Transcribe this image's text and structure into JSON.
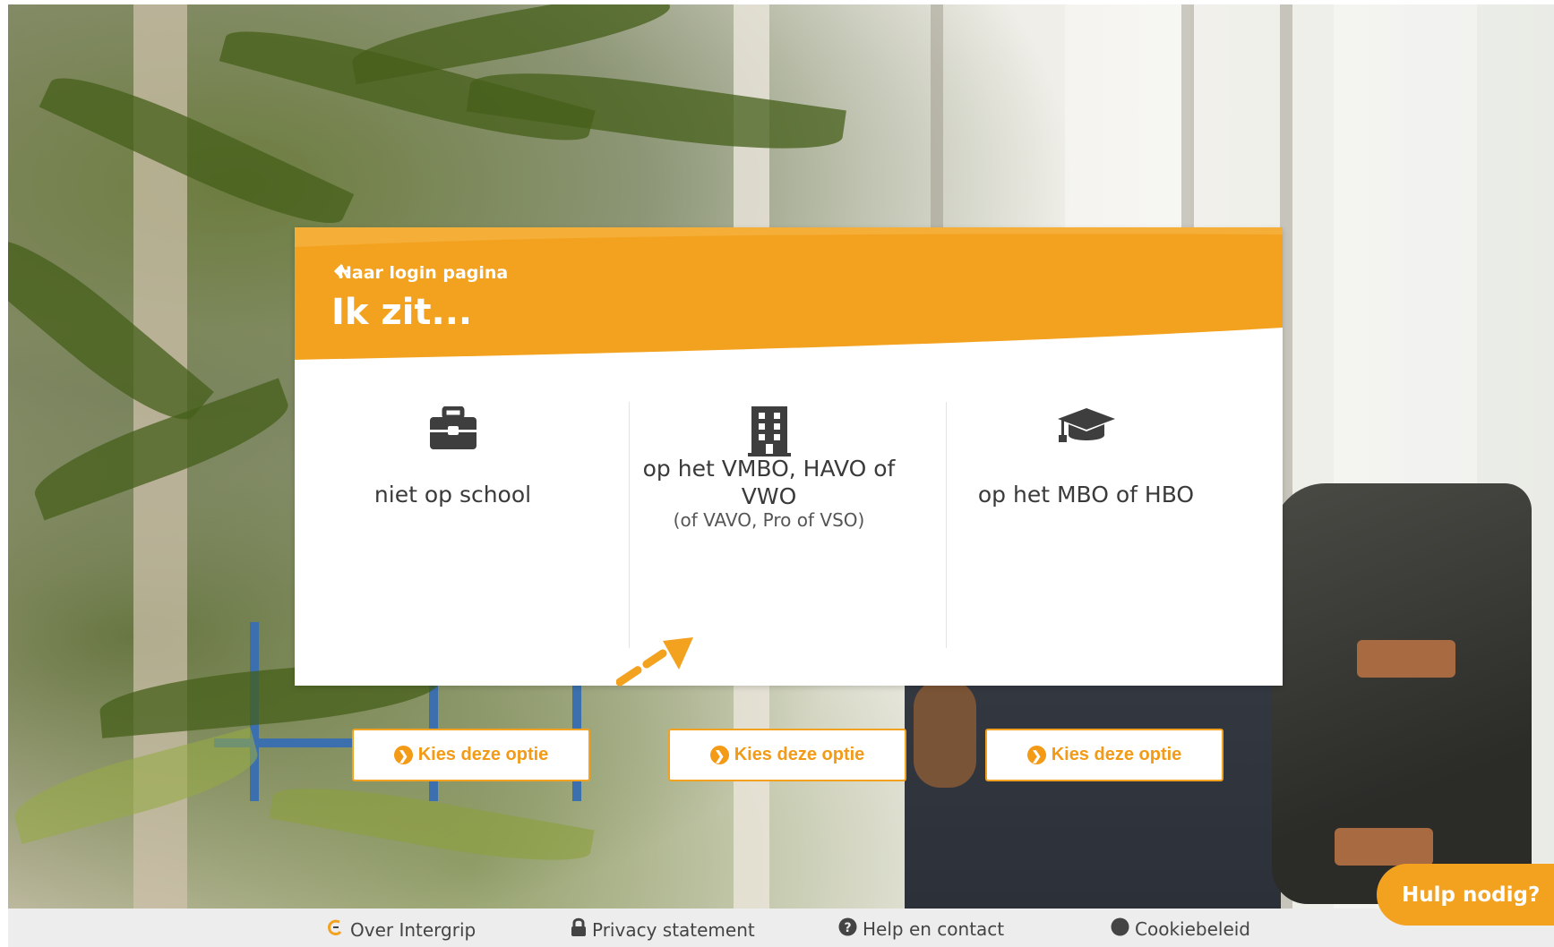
{
  "colors": {
    "brand_orange": "#f3a21f",
    "button_text": "#f39a16",
    "footer_bg": "#ededed"
  },
  "card": {
    "back_link": "Naar login pagina",
    "title": "Ik zit...",
    "options": [
      {
        "icon": "briefcase-icon",
        "title": "niet op school",
        "subtitle": "",
        "button": "Kies deze optie"
      },
      {
        "icon": "building-icon",
        "title": "op het VMBO, HAVO of VWO",
        "subtitle": "(of VAVO, Pro of VSO)",
        "button": "Kies deze optie"
      },
      {
        "icon": "graduation-cap-icon",
        "title": "op het MBO of HBO",
        "subtitle": "",
        "button": "Kies deze optie"
      }
    ]
  },
  "footer": {
    "links": [
      {
        "icon": "intergrip-logo-icon",
        "label": "Over Intergrip"
      },
      {
        "icon": "lock-icon",
        "label": "Privacy statement"
      },
      {
        "icon": "question-circle-icon",
        "label": "Help en contact"
      },
      {
        "icon": "circle-icon",
        "label": "Cookiebeleid"
      }
    ]
  },
  "help_button": "Hulp nodig?"
}
